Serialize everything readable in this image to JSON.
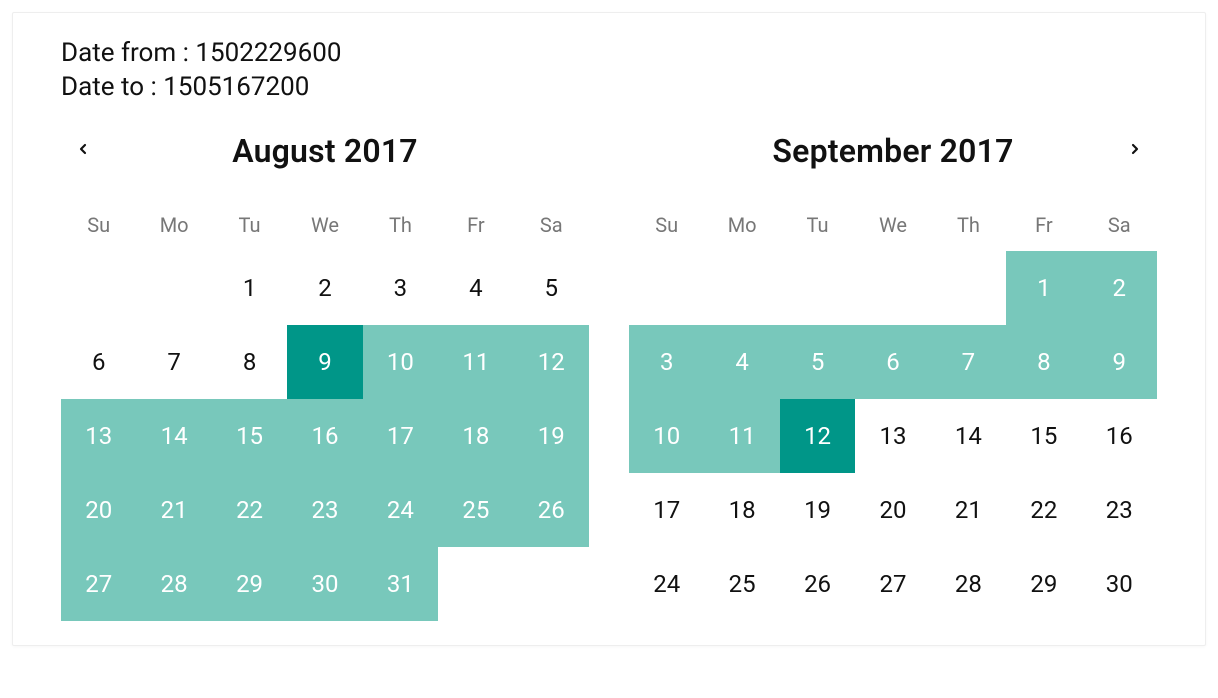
{
  "date_from_label": "Date from : ",
  "date_from_value": "1502229600",
  "date_to_label": "Date to : ",
  "date_to_value": "1505167200",
  "colors": {
    "range": "#78c8bb",
    "endpoint": "#009688"
  },
  "weekdays": [
    "Su",
    "Mo",
    "Tu",
    "We",
    "Th",
    "Fr",
    "Sa"
  ],
  "range": {
    "start": "2017-08-09",
    "end": "2017-09-12"
  },
  "months": [
    {
      "id": "left",
      "title": "August  2017",
      "year": 2017,
      "monthIndex": 8,
      "leading_blanks": 2,
      "days_in_month": 31
    },
    {
      "id": "right",
      "title": "September  2017",
      "year": 2017,
      "monthIndex": 9,
      "leading_blanks": 5,
      "days_in_month": 30
    }
  ]
}
